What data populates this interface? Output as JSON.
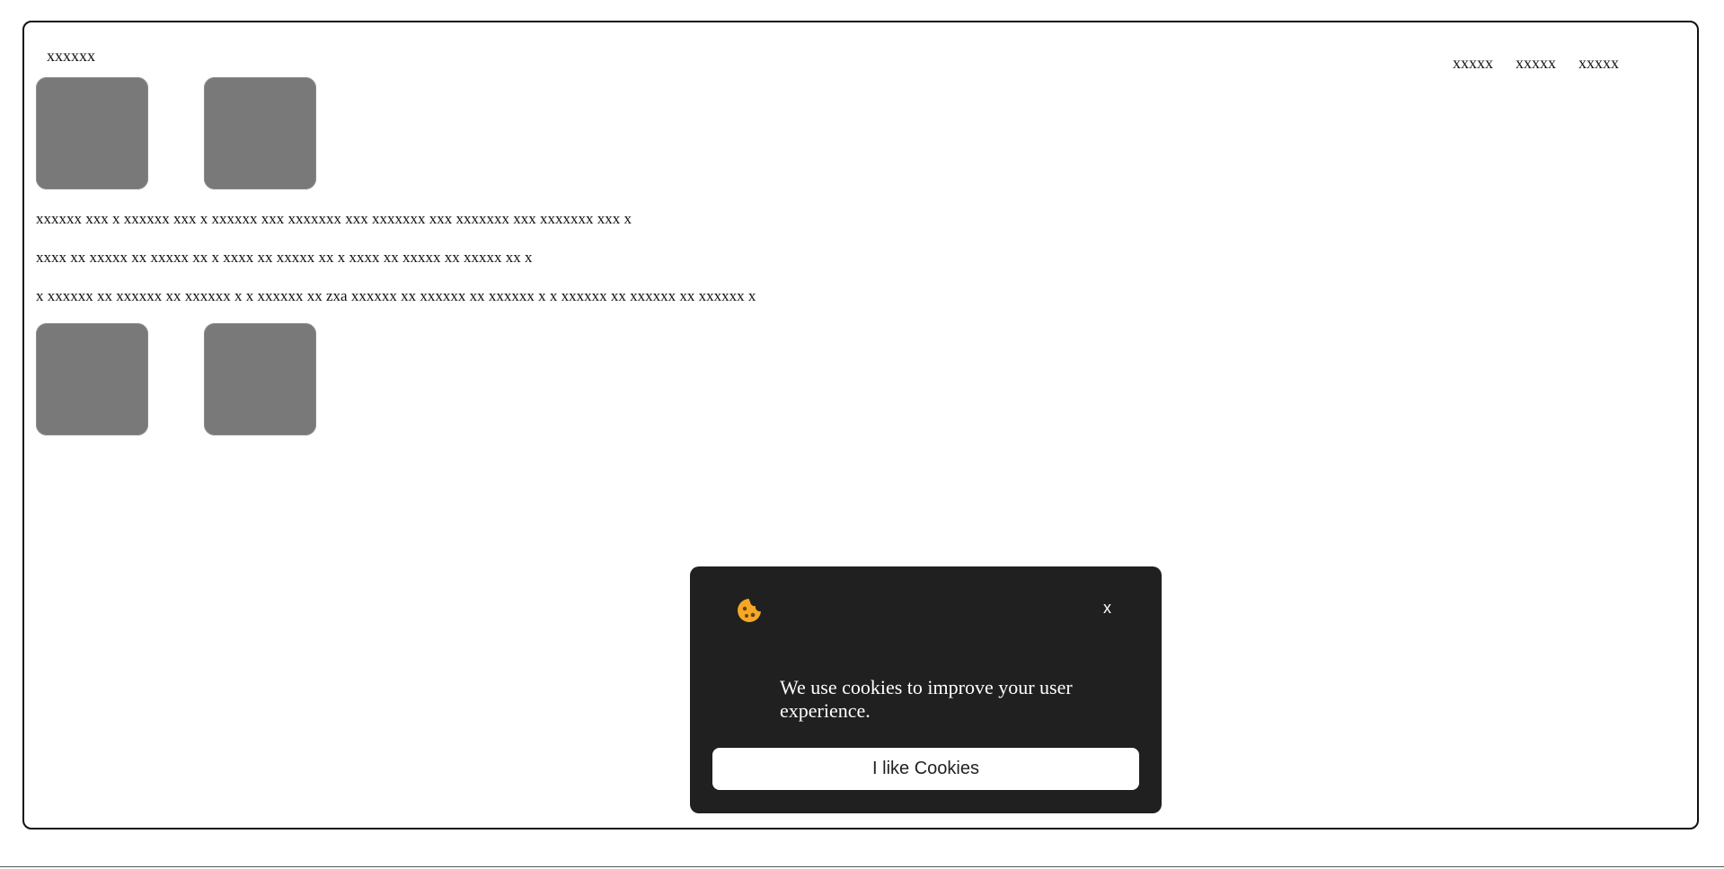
{
  "header": {
    "logo": "xxxxxx",
    "nav": [
      "xxxxx",
      "xxxxx",
      "xxxxx"
    ]
  },
  "content": {
    "paragraphs": [
      "xxxxxx xxx x xxxxxx xxx x xxxxxx xxx xxxxxxx xxx xxxxxxx xxx xxxxxxx xxx xxxxxxx xxx x",
      "xxxx xx xxxxx xx xxxxx xx x xxxx xx xxxxx xx x xxxx xx xxxxx xx xxxxx xx x",
      "x xxxxxx xx xxxxxx xx xxxxxx x x xxxxxx xx zxa xxxxxx xx xxxxxx xx xxxxxx x x xxxxxx xx xxxxxx xx xxxxxx x"
    ]
  },
  "cookie_banner": {
    "icon": "cookie-icon",
    "close_label": "x",
    "message": "We use cookies to improve your user experience.",
    "accept_label": "I like Cookies"
  },
  "colors": {
    "image_placeholder": "#797979",
    "banner_bg": "#202020",
    "cookie_orange": "#f4a825"
  }
}
